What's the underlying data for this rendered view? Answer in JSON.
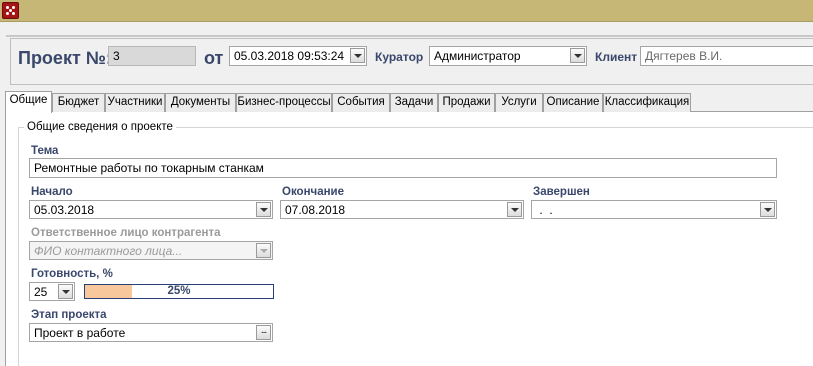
{
  "app": {
    "icon": "app-logo-icon"
  },
  "header": {
    "project_label": "Проект №:",
    "project_number": "3",
    "from_label": "от",
    "date": "05.03.2018 09:53:24",
    "curator_label": "Куратор",
    "curator": "Администратор",
    "client_label": "Клиент",
    "client": "Дягтерев В.И."
  },
  "tabs": [
    "Общие",
    "Бюджет",
    "Участники",
    "Документы",
    "Бизнес-процессы",
    "События",
    "Задачи",
    "Продажи",
    "Услуги",
    "Описание",
    "Классификация"
  ],
  "active_tab": "Общие",
  "group": {
    "title": "Общие сведения о проекте",
    "theme_label": "Тема",
    "theme": "Ремонтные работы по токарным станкам",
    "start_label": "Начало",
    "start": "05.03.2018",
    "end_label": "Окончание",
    "end": "07.08.2018",
    "done_label": "Завершен",
    "done": " .  .",
    "contact_label": "Ответственное лицо контрагента",
    "contact_placeholder": "ФИО контактного лица...",
    "ready_label": "Готовность, %",
    "ready_value": "25",
    "progress_text": "25%",
    "progress_fraction": 0.25,
    "stage_label": "Этап проекта",
    "stage": "Проект в работе",
    "stage_button": "..."
  }
}
